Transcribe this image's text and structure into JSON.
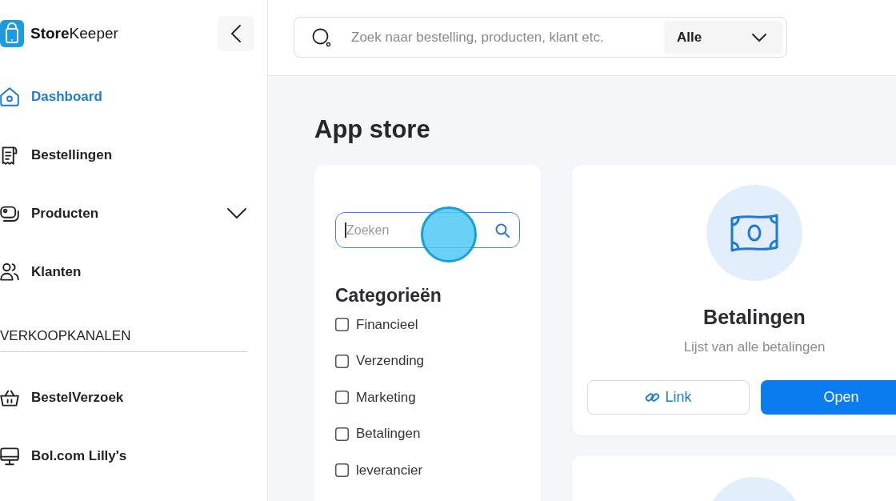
{
  "brand": {
    "name": "**Store**Keeper"
  },
  "sidebar": {
    "items": [
      {
        "label": "Dashboard",
        "kind": "link",
        "selected": true
      },
      {
        "label": "Bestellingen",
        "kind": "link",
        "selected": false
      },
      {
        "label": "Producten",
        "kind": "group",
        "selected": false,
        "expanded": false
      },
      {
        "label": "Klanten",
        "kind": "link",
        "selected": false
      }
    ],
    "sections": [
      {
        "title": "VERKOOPKANALEN",
        "items": [
          {
            "label": "BestelVerzoek",
            "selected": false
          },
          {
            "label": "Bol.com Lilly's",
            "selected": false
          }
        ]
      }
    ]
  },
  "top_search": {
    "placeholder": "Zoek naar bestelling, producten, klant etc.",
    "scope": "Alle"
  },
  "page": {
    "title": "App store"
  },
  "filters": {
    "search": {
      "placeholder": "Zoeken",
      "focused": true
    },
    "title": "Categorieën",
    "categories": [
      {
        "label": "Financieel",
        "checked": false
      },
      {
        "label": "Verzending",
        "checked": false
      },
      {
        "label": "Marketing",
        "checked": false
      },
      {
        "label": "Betalingen",
        "checked": false
      },
      {
        "label": "leverancier",
        "checked": false
      }
    ]
  },
  "apps": [
    {
      "title": "Betalingen",
      "description": "Lijst van alle betalingen",
      "buttons": [
        {
          "label": "Link",
          "kind": "secondary"
        },
        {
          "label": "Open",
          "kind": "primary"
        }
      ]
    }
  ]
}
